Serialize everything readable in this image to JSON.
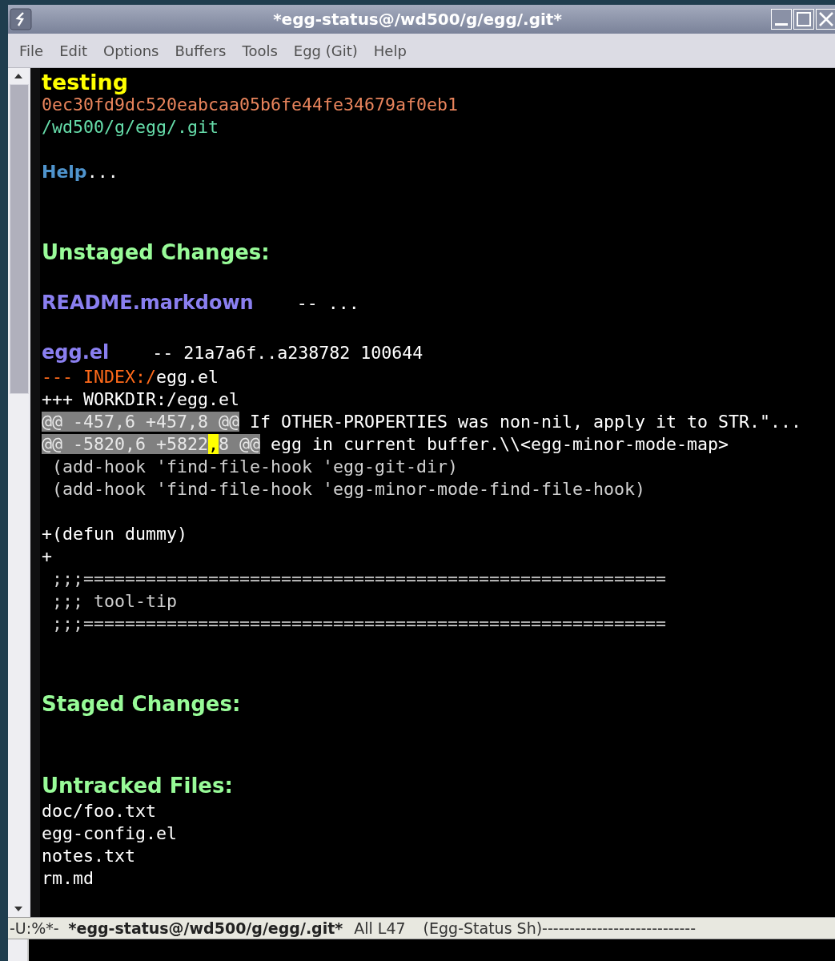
{
  "window": {
    "title": "*egg-status@/wd500/g/egg/.git*"
  },
  "menu": [
    "File",
    "Edit",
    "Options",
    "Buffers",
    "Tools",
    "Egg (Git)",
    "Help"
  ],
  "buffer": {
    "branch": "testing",
    "commit": "0ec30fd9dc520eabcaa05b6fe44fe34679af0eb1",
    "git_dir": "/wd500/g/egg/.git",
    "help": {
      "label": "Help",
      "suffix": "..."
    },
    "sections": [
      {
        "title": "Unstaged Changes:",
        "files": [
          {
            "name": "README.markdown",
            "info": "-- ..."
          },
          {
            "name": "egg.el",
            "info": "-- 21a7a6f..a238782 100644",
            "diff": [
              {
                "kind": "old_file",
                "prefix": "--- INDEX:/",
                "path": "egg.el"
              },
              {
                "kind": "new_file",
                "text": "+++ WORKDIR:/egg.el"
              },
              {
                "kind": "hunk",
                "header": [
                  {
                    "text": "@@ -457,6 +457,8 @@",
                    "cursor": false
                  }
                ],
                "text": " If OTHER-PROPERTIES was non-nil, apply it to STR.\"..."
              },
              {
                "kind": "hunk",
                "header": [
                  {
                    "text": "@@ -5820,6 +5822",
                    "cursor": false
                  },
                  {
                    "text": ",",
                    "cursor": true
                  },
                  {
                    "text": "8 @@",
                    "cursor": false
                  }
                ],
                "text": " egg in current buffer.\\\\<egg-minor-mode-map>"
              },
              {
                "kind": "context",
                "text": " (add-hook 'find-file-hook 'egg-git-dir)"
              },
              {
                "kind": "context",
                "text": " (add-hook 'find-file-hook 'egg-minor-mode-find-file-hook)"
              },
              {
                "kind": "blank"
              },
              {
                "kind": "added",
                "text": "+(defun dummy)"
              },
              {
                "kind": "added",
                "text": "+"
              },
              {
                "kind": "context",
                "text": " ;;;========================================================"
              },
              {
                "kind": "context",
                "text": " ;;; tool-tip"
              },
              {
                "kind": "context",
                "text": " ;;;========================================================"
              }
            ]
          }
        ]
      },
      {
        "title": "Staged Changes:"
      },
      {
        "title": "Untracked Files:",
        "untracked": [
          "doc/foo.txt",
          "egg-config.el",
          "notes.txt",
          "rm.md"
        ]
      }
    ]
  },
  "mode_line": {
    "state": "-U:%*-",
    "buffer": "*egg-status@/wd500/g/egg/.git*",
    "position": "All L47",
    "mode": "(Egg-Status Sh)----------------------------"
  }
}
